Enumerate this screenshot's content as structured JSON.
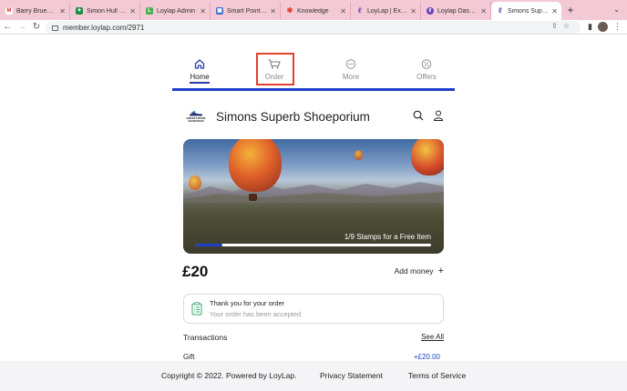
{
  "browser": {
    "tabs": [
      {
        "title": "Barry Bruen mess",
        "icon": "gmail-icon",
        "color": "#d93025"
      },
      {
        "title": "Simon Hull - Chat",
        "icon": "chat-icon",
        "color": "#1e8e3e"
      },
      {
        "title": "Loylap Admin",
        "icon": "loylap-admin-icon",
        "color": "#4caf50"
      },
      {
        "title": "Smart Points Ltd",
        "icon": "smartpoints-icon",
        "color": "#3b6ccf"
      },
      {
        "title": "Knowledge",
        "icon": "knowledge-icon",
        "color": "#e2412d"
      },
      {
        "title": "LoyLap | Experie",
        "icon": "loylap-icon",
        "color": "#6b3fbf"
      },
      {
        "title": "Loylap Dashboar",
        "icon": "loylap-dashboard-icon",
        "color": "#6b3fbf"
      },
      {
        "title": "Simons Superb S",
        "icon": "loylap-icon",
        "color": "#6b3fbf",
        "active": true
      }
    ],
    "url": "member.loylap.com/2971"
  },
  "nav": {
    "home": "Home",
    "order": "Order",
    "more": "More",
    "offers": "Offers",
    "accent": "#1d3fc9",
    "highlight": "#e2412d"
  },
  "shop": {
    "name": "Simons Superb Shoeporium",
    "logo_text": "SIMONS SUPERB SHOEPORIUM"
  },
  "banner": {
    "stamps_text": "1/9 Stamps for a Free Item",
    "stamps_collected": 1,
    "stamps_total": 9
  },
  "wallet": {
    "balance": "£20",
    "add_money": "Add money"
  },
  "order_notice": {
    "title": "Thank you for your order",
    "subtitle": "Your order has been accepted"
  },
  "transactions": {
    "title": "Transactions",
    "see_all": "See All",
    "items": [
      {
        "name": "Gift",
        "amount": "+£20.00"
      }
    ]
  },
  "footer": {
    "copyright": "Copyright © 2022. Powered by LoyLap.",
    "privacy": "Privacy Statement",
    "terms": "Terms of Service"
  }
}
